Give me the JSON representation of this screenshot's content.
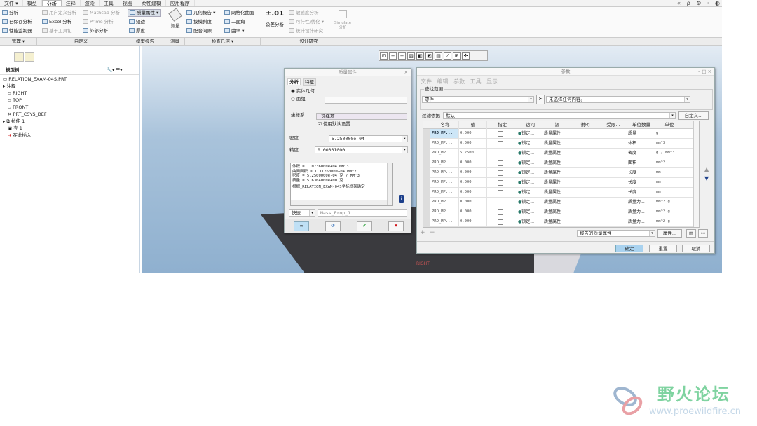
{
  "tabs": [
    "文件 ▾",
    "模型",
    "分析",
    "注释",
    "渲染",
    "工具",
    "视图",
    "柔性建模",
    "应用程序"
  ],
  "top_icons": "« ρ ⚙ · ◐",
  "ribbon": {
    "manage": [
      "分析",
      "已保存分析",
      "性能监视器"
    ],
    "custom": [
      "用户定义分析",
      "Excel 分析",
      "基于工具包",
      "Mathcad 分析",
      "Prime 分析",
      "外部分析"
    ],
    "model_report": [
      "质量属性",
      "短边",
      "厚度"
    ],
    "measure": "测量",
    "inspect": [
      "几何报告",
      "拔模斜度",
      "配合间隙",
      "网格化曲面",
      "二面角",
      "曲率"
    ],
    "tolerance": "公差分析",
    "tolerance_icon": "±.01",
    "design": [
      "敏感度分析",
      "可行性/优化",
      "统计设计研究"
    ],
    "simulate": [
      "Simulate",
      "分析"
    ]
  },
  "groups": [
    "管理 ▾",
    "自定义",
    "模型报告",
    "测量",
    "检查几何 ▾",
    "设计研究"
  ],
  "left_panel": {
    "title": "模型树",
    "items": [
      "RELATION_EXAM-04S.PRT",
      "注释",
      "RIGHT",
      "TOP",
      "FRONT",
      "PRT_CSYS_DEF",
      "拉伸 1",
      "壳 1",
      "在此插入"
    ]
  },
  "viewport": {
    "plane_label": "RIGHT"
  },
  "mass_dialog": {
    "title": "质量属性",
    "tabs": [
      "分析",
      "特征"
    ],
    "radio1": "实体几何",
    "radio2": "面组",
    "csys_label": "坐标系",
    "csys_value": "选择项",
    "use_default": "使用默认设置",
    "density_label": "密度",
    "density_value": "5.250000e-04",
    "accuracy_label": "精度",
    "accuracy_value": "0.00001000",
    "results": [
      "体积 =  1.0736000e+04  MM^3",
      "曲面面积 =  1.1176000e+04  MM^2",
      "密度 =  5.2500000e-04 克 / MM^3",
      "质量 =  5.6364000e+00 克",
      "根据_RELATION_EXAM-04S坐标框架确定"
    ],
    "mode": "快速",
    "name": "Mass_Prop_1"
  },
  "param_dialog": {
    "title": "参数",
    "menu": [
      "文件",
      "编辑",
      "参数",
      "工具",
      "显示"
    ],
    "scope_label": "查找范围",
    "scope_value": "零件",
    "select_value": "未选择任何内容。",
    "filter_label": "过滤依据",
    "filter_value": "默认",
    "customize": "自定义...",
    "columns": [
      "名称",
      "值",
      "指定",
      "访问",
      "源",
      "说明",
      "受限...",
      "单位数量",
      "单位"
    ],
    "rows": [
      [
        "PRO_MP...",
        "0.000",
        "锁定...",
        "质量属性",
        "质量",
        "g"
      ],
      [
        "PRO_MP...",
        "0.000",
        "锁定...",
        "质量属性",
        "体积",
        "mm^3"
      ],
      [
        "PRO_MP...",
        "5.2500...",
        "锁定...",
        "质量属性",
        "密度",
        "g / mm^3"
      ],
      [
        "PRO_MP...",
        "0.000",
        "锁定...",
        "质量属性",
        "面积",
        "mm^2"
      ],
      [
        "PRO_MP...",
        "0.000",
        "锁定...",
        "质量属性",
        "长度",
        "mm"
      ],
      [
        "PRO_MP...",
        "0.000",
        "锁定...",
        "质量属性",
        "长度",
        "mm"
      ],
      [
        "PRO_MP...",
        "0.000",
        "锁定...",
        "质量属性",
        "长度",
        "mm"
      ],
      [
        "PRO_MP...",
        "0.000",
        "锁定...",
        "质量属性",
        "质量力...",
        "mm^2 g"
      ],
      [
        "PRO_MP...",
        "0.000",
        "锁定...",
        "质量属性",
        "质量力...",
        "mm^2 g"
      ],
      [
        "PRO_MP...",
        "0.000",
        "锁定...",
        "质量属性",
        "质量力...",
        "mm^2 g"
      ]
    ],
    "report_select": "报告的质量属性",
    "properties": "属性...",
    "ok": "确定",
    "reset": "重置",
    "cancel": "取消"
  },
  "watermark": {
    "title": "野火论坛",
    "url": "www.proewildfire.cn"
  }
}
